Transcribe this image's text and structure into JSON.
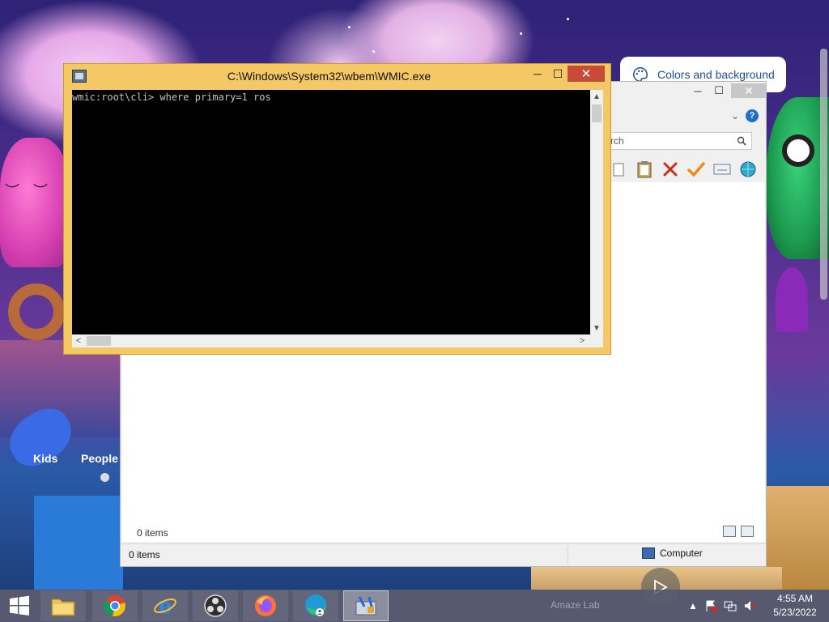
{
  "console": {
    "title": "C:\\Windows\\System32\\wbem\\WMIC.exe",
    "minimize": "─",
    "maximize": "☐",
    "close": "✕",
    "output_line": "wmic:root\\cli> where primary=1 ros",
    "scroll_up": "▲",
    "scroll_down": "▼",
    "scroll_left": "<",
    "scroll_right": ">"
  },
  "settings_pill": {
    "label": "Colors and background",
    "icon": "palette-icon"
  },
  "explorer": {
    "minimize": "─",
    "maximize": "☐",
    "close": "✕",
    "search_placeholder": "rch",
    "help": "?",
    "items_count_inner": "0 items",
    "status_items": "0 items",
    "status_location": "Computer",
    "toolbar_icons": [
      "copy-icon",
      "paste-icon",
      "delete-icon",
      "check-icon",
      "rename-icon",
      "globe-icon"
    ]
  },
  "wallpaper": {
    "labels": [
      "Kids",
      "People"
    ]
  },
  "taskbar": {
    "apps": [
      {
        "name": "file-explorer",
        "icon": "folder-icon"
      },
      {
        "name": "chrome",
        "icon": "chrome-icon"
      },
      {
        "name": "internet-explorer",
        "icon": "ie-icon"
      },
      {
        "name": "obs",
        "icon": "obs-icon"
      },
      {
        "name": "firefox",
        "icon": "firefox-icon"
      },
      {
        "name": "edge",
        "icon": "edge-icon"
      },
      {
        "name": "control-panel-tool",
        "icon": "tools-icon"
      }
    ],
    "watermark": "Amaze Lab",
    "clock_time": "4:55 AM",
    "clock_date": "5/23/2022"
  }
}
